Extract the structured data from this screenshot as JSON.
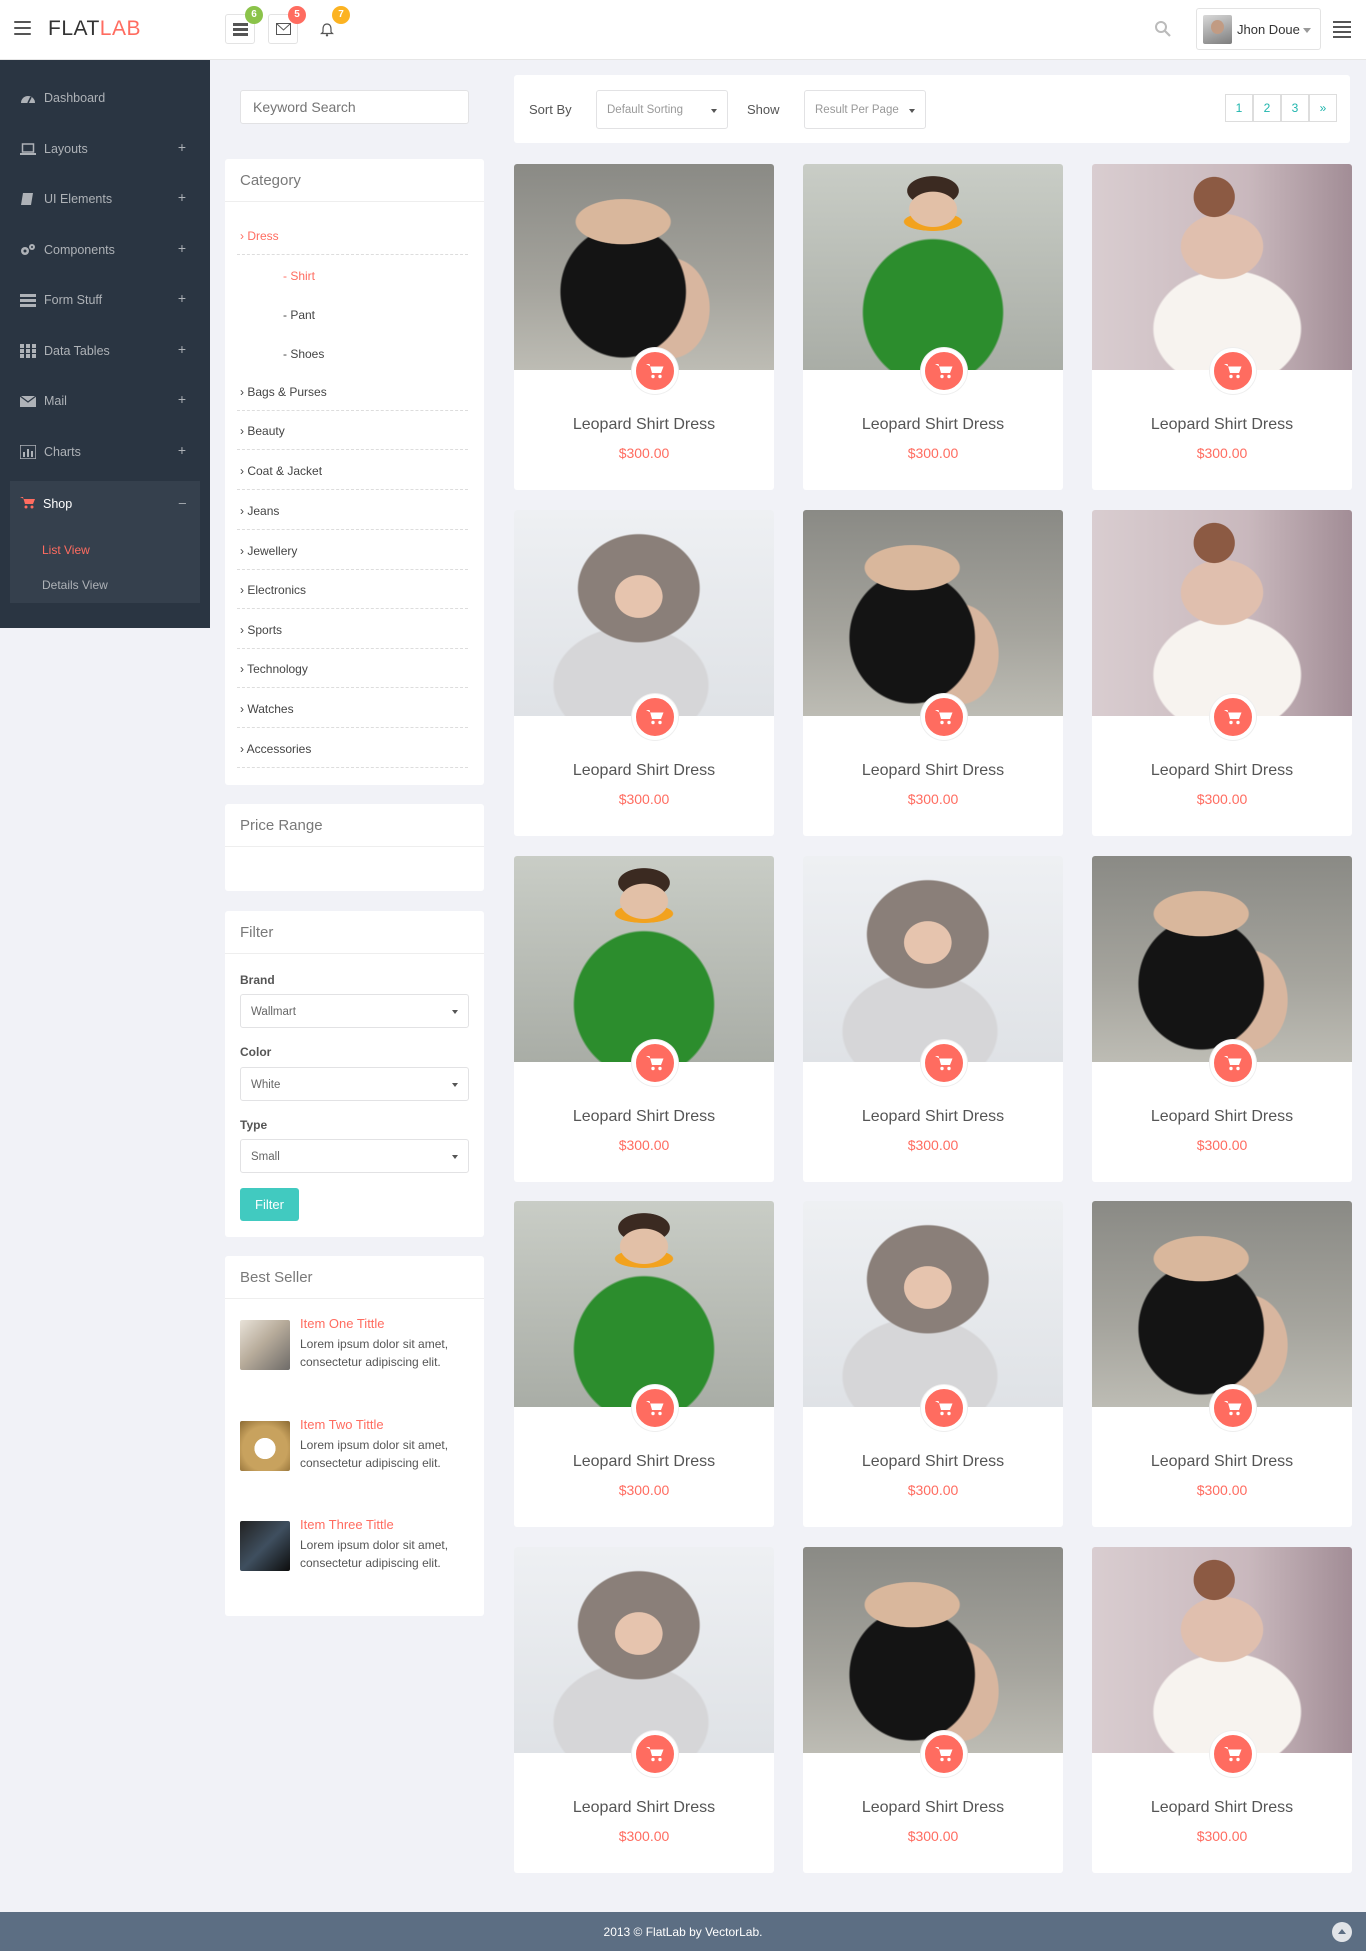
{
  "header": {
    "logo_main": "FLAT",
    "logo_accent": "LAB",
    "notifications": [
      {
        "icon": "tasks-icon",
        "count": "6",
        "color": "#8bc34a"
      },
      {
        "icon": "envelope-icon",
        "count": "5",
        "color": "#ff6c60"
      },
      {
        "icon": "bell-icon",
        "count": "7",
        "color": "#fcb322"
      }
    ],
    "user_name": "Jhon Doue"
  },
  "sidebar": {
    "items": [
      {
        "label": "Dashboard",
        "icon": "dashboard-icon",
        "plus": ""
      },
      {
        "label": "Layouts",
        "icon": "laptop-icon",
        "plus": "+"
      },
      {
        "label": "UI Elements",
        "icon": "book-icon",
        "plus": "+"
      },
      {
        "label": "Components",
        "icon": "cogs-icon",
        "plus": "+"
      },
      {
        "label": "Form Stuff",
        "icon": "tasks-icon",
        "plus": "+"
      },
      {
        "label": "Data Tables",
        "icon": "th-icon",
        "plus": "+"
      },
      {
        "label": "Mail",
        "icon": "envelope-icon",
        "plus": "+"
      },
      {
        "label": "Charts",
        "icon": "chart-icon",
        "plus": "+"
      }
    ],
    "shop": {
      "label": "Shop",
      "icon": "cart-icon",
      "toggle": "–",
      "sub": [
        "List View",
        "Details View"
      ]
    }
  },
  "search": {
    "placeholder": "Keyword Search"
  },
  "category": {
    "title": "Category",
    "active": "Dress",
    "subs": [
      "- Shirt",
      "- Pant",
      "- Shoes"
    ],
    "items": [
      "Bags & Purses",
      "Beauty",
      "Coat & Jacket",
      "Jeans",
      "Jewellery",
      "Electronics",
      "Sports",
      "Technology",
      "Watches",
      "Accessories"
    ]
  },
  "price_range": {
    "title": "Price Range"
  },
  "filter": {
    "title": "Filter",
    "brand_label": "Brand",
    "brand_value": "Wallmart",
    "color_label": "Color",
    "color_value": "White",
    "type_label": "Type",
    "type_value": "Small",
    "button": "Filter"
  },
  "best_seller": {
    "title": "Best Seller",
    "items": [
      {
        "title": "Item One Tittle",
        "desc": "Lorem ipsum dolor sit amet, consectetur adipiscing elit."
      },
      {
        "title": "Item Two Tittle",
        "desc": "Lorem ipsum dolor sit amet, consectetur adipiscing elit."
      },
      {
        "title": "Item Three Tittle",
        "desc": "Lorem ipsum dolor sit amet, consectetur adipiscing elit."
      }
    ]
  },
  "toolbar": {
    "sort_label": "Sort By",
    "sort_value": "Default Sorting",
    "show_label": "Show",
    "show_value": "Result Per Page",
    "pages": [
      "1",
      "2",
      "3",
      "»"
    ]
  },
  "products": [
    {
      "name": "Leopard Shirt Dress",
      "price": "$300.00",
      "photo": "dark"
    },
    {
      "name": "Leopard Shirt Dress",
      "price": "$300.00",
      "photo": "green"
    },
    {
      "name": "Leopard Shirt Dress",
      "price": "$300.00",
      "photo": "bride"
    },
    {
      "name": "Leopard Shirt Dress",
      "price": "$300.00",
      "photo": "fur"
    },
    {
      "name": "Leopard Shirt Dress",
      "price": "$300.00",
      "photo": "dark"
    },
    {
      "name": "Leopard Shirt Dress",
      "price": "$300.00",
      "photo": "bride"
    },
    {
      "name": "Leopard Shirt Dress",
      "price": "$300.00",
      "photo": "green"
    },
    {
      "name": "Leopard Shirt Dress",
      "price": "$300.00",
      "photo": "fur"
    },
    {
      "name": "Leopard Shirt Dress",
      "price": "$300.00",
      "photo": "dark"
    },
    {
      "name": "Leopard Shirt Dress",
      "price": "$300.00",
      "photo": "green"
    },
    {
      "name": "Leopard Shirt Dress",
      "price": "$300.00",
      "photo": "fur"
    },
    {
      "name": "Leopard Shirt Dress",
      "price": "$300.00",
      "photo": "dark"
    },
    {
      "name": "Leopard Shirt Dress",
      "price": "$300.00",
      "photo": "fur"
    },
    {
      "name": "Leopard Shirt Dress",
      "price": "$300.00",
      "photo": "dark"
    },
    {
      "name": "Leopard Shirt Dress",
      "price": "$300.00",
      "photo": "bride"
    }
  ],
  "footer": {
    "text": "2013 © FlatLab by VectorLab."
  },
  "colors": {
    "accent": "#ff6c60",
    "sidebar": "#2a3542",
    "teal": "#41cac0",
    "pager": "#1fb5ad",
    "footer": "#5c6e83"
  }
}
